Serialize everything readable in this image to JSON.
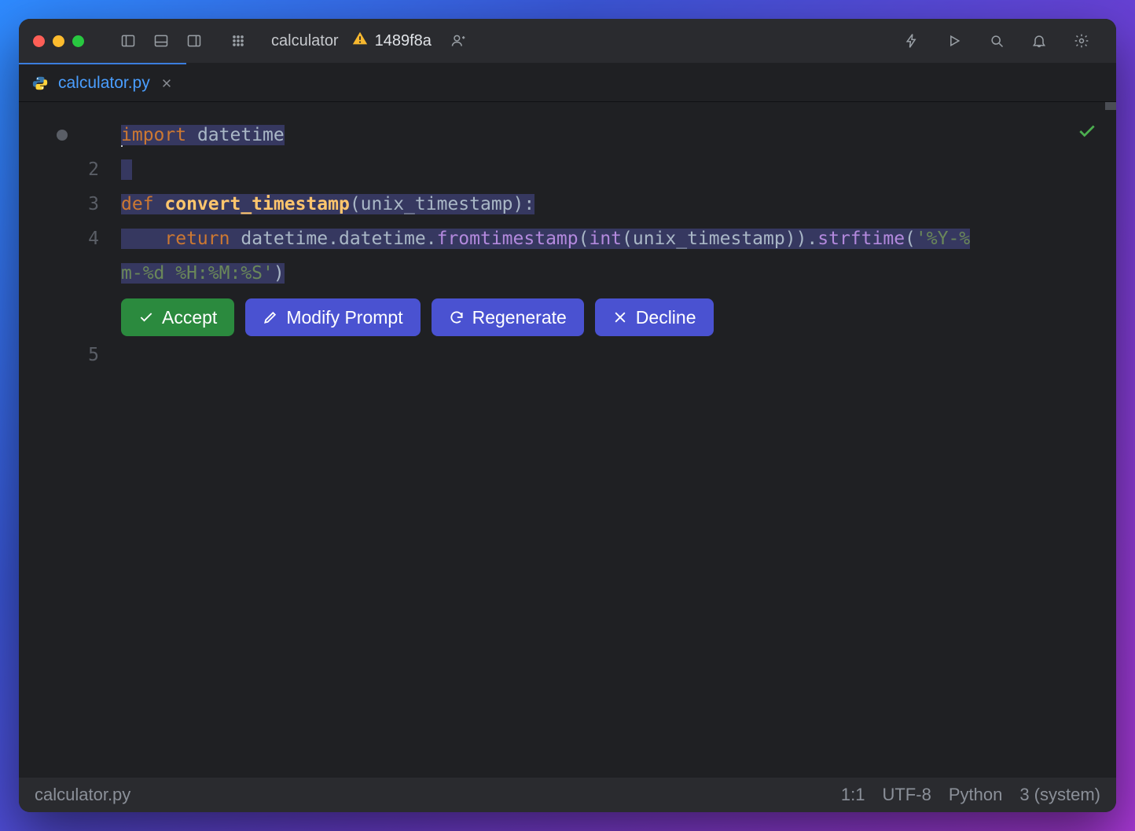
{
  "titlebar": {
    "project": "calculator",
    "warning_commit": "1489f8a"
  },
  "tab": {
    "filename": "calculator.py"
  },
  "gutter": {
    "lines": [
      "",
      "2",
      "3",
      "4",
      "",
      "5"
    ]
  },
  "code": {
    "l1": {
      "kw": "import",
      "mod": "datetime"
    },
    "l3": {
      "kw": "def",
      "fn": "convert_timestamp",
      "args": "(unix_timestamp):"
    },
    "l4a": {
      "indent": "    ",
      "kw": "return",
      "expr": "datetime.datetime.",
      "call1": "fromtimestamp",
      "p1": "(",
      "call2": "int",
      "p2": "(unix_timestamp)).",
      "call3": "strftime",
      "p3": "(",
      "str": "'%Y-%"
    },
    "l4b": {
      "str": "m-%d %H:%M:%S'",
      "close": ")"
    }
  },
  "actions": {
    "accept": "Accept",
    "modify": "Modify Prompt",
    "regen": "Regenerate",
    "decline": "Decline"
  },
  "status": {
    "file": "calculator.py",
    "pos": "1:1",
    "encoding": "UTF-8",
    "lang": "Python",
    "runtime": "3 (system)"
  }
}
